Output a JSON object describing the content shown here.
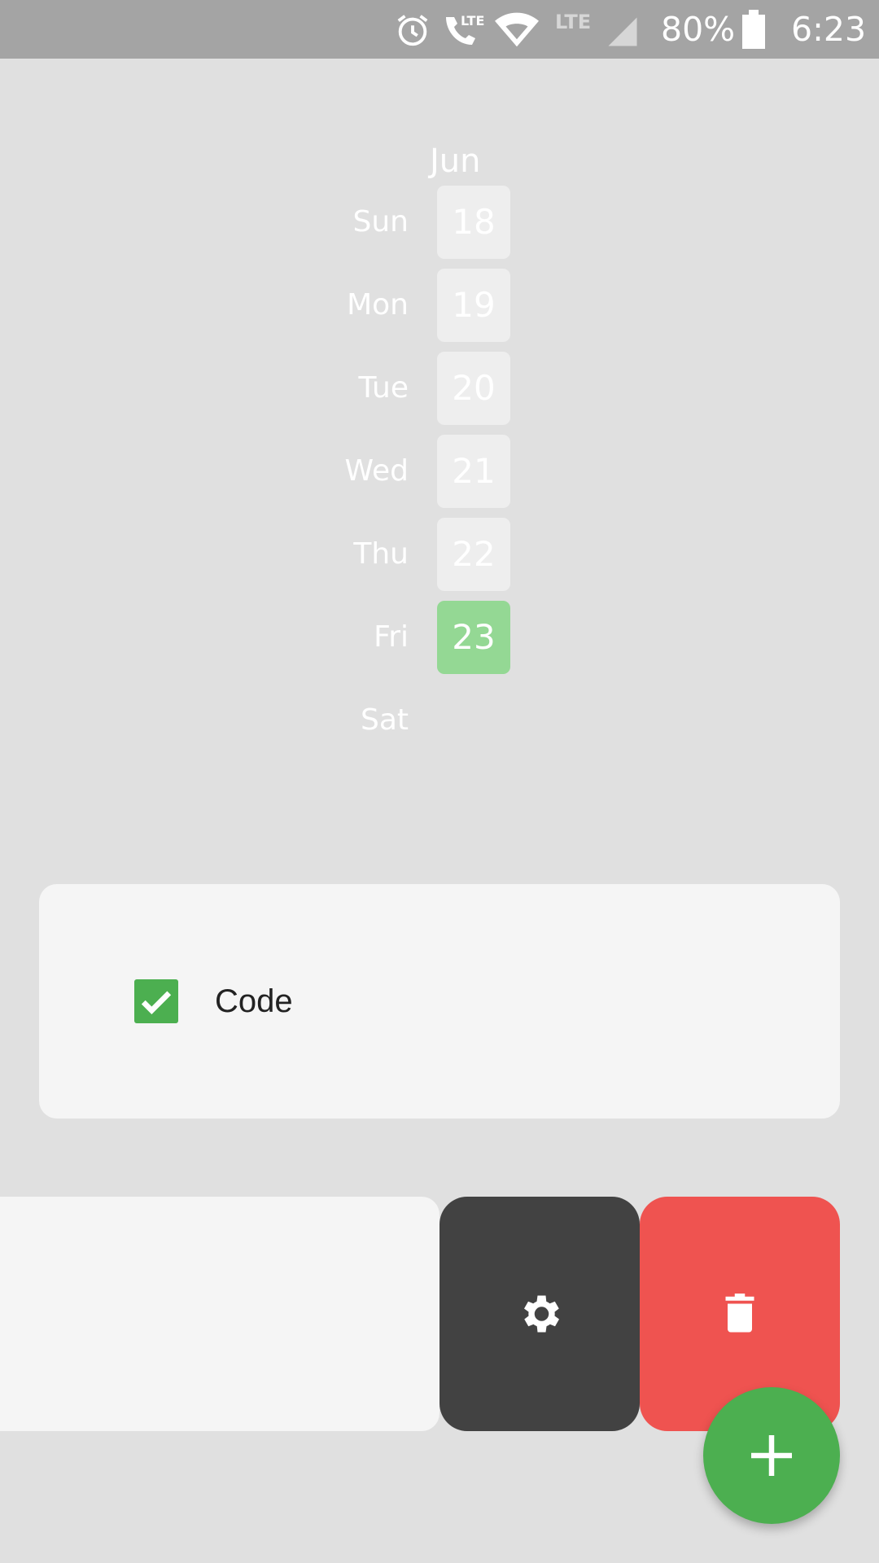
{
  "status_bar": {
    "battery_percent": "80%",
    "time": "6:23",
    "icons": [
      "alarm-icon",
      "lte-call-icon",
      "wifi-icon",
      "lte-icon",
      "signal-icon",
      "battery-icon"
    ]
  },
  "calendar": {
    "month": "Jun",
    "days": [
      {
        "name": "Sun",
        "date": "18",
        "completed": false
      },
      {
        "name": "Mon",
        "date": "19",
        "completed": false
      },
      {
        "name": "Tue",
        "date": "20",
        "completed": false
      },
      {
        "name": "Wed",
        "date": "21",
        "completed": false
      },
      {
        "name": "Thu",
        "date": "22",
        "completed": false
      },
      {
        "name": "Fri",
        "date": "23",
        "completed": true
      },
      {
        "name": "Sat",
        "date": "",
        "completed": false
      }
    ]
  },
  "task": {
    "label": "Code",
    "checked": true
  },
  "actions": {
    "settings_icon": "gear-icon",
    "delete_icon": "trash-icon",
    "add_icon": "plus-icon"
  },
  "colors": {
    "completed_day": "#94d894",
    "checkbox": "#4caf50",
    "settings_action": "#424242",
    "delete_action": "#ef5350",
    "fab": "#4caf50"
  }
}
